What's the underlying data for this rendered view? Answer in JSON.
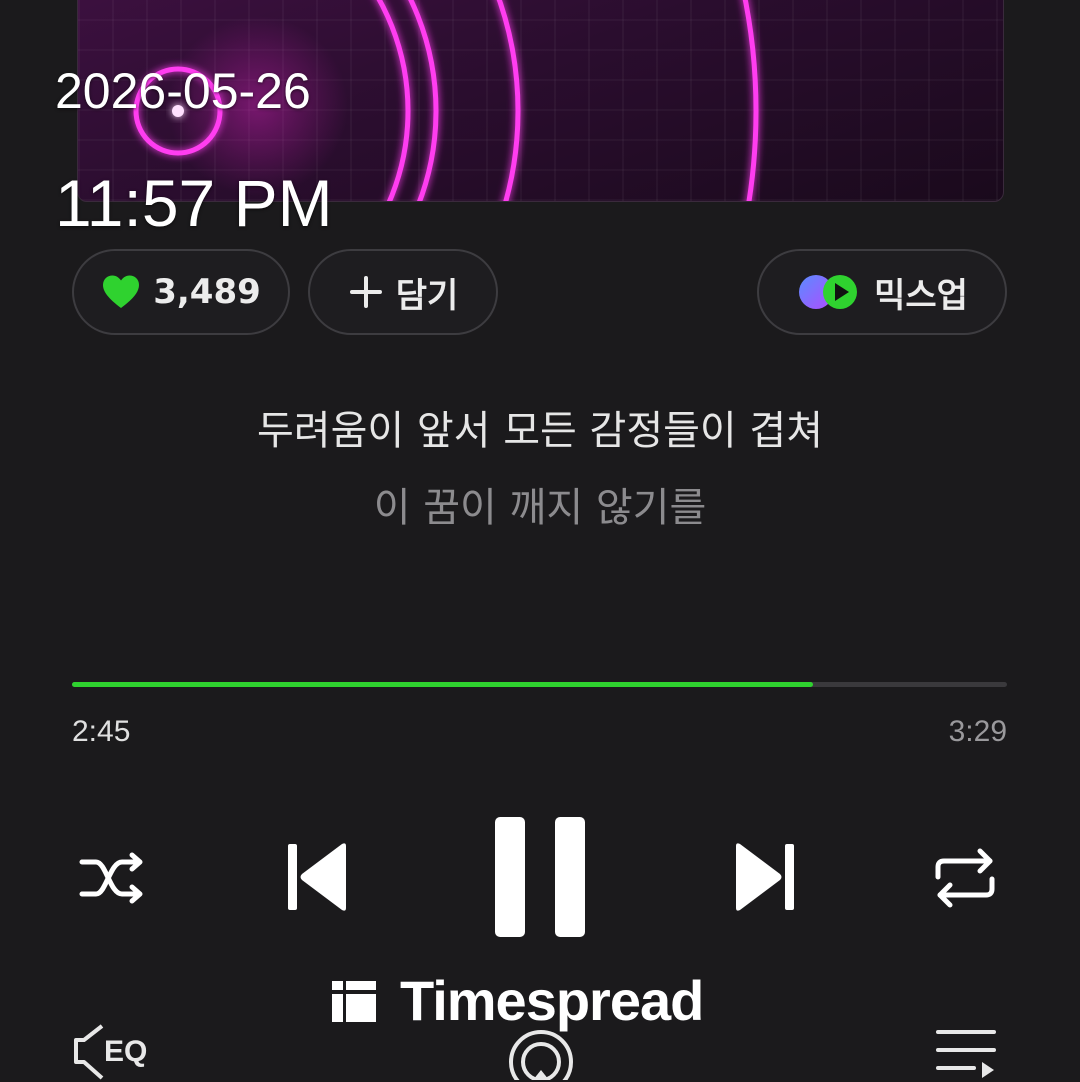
{
  "overlay": {
    "date": "2026-05-26",
    "time": "11:57 PM"
  },
  "actions": {
    "like_count": "3,489",
    "add_label": "담기",
    "mixup_label": "믹스업"
  },
  "lyrics": {
    "current": "두려움이 앞서 모든 감정들이 겹쳐",
    "next": "이 꿈이 깨지 않기를"
  },
  "progress": {
    "elapsed": "2:45",
    "total": "3:29",
    "fraction": 0.793
  },
  "controls": {
    "shuffle": "shuffle-icon",
    "previous": "previous-icon",
    "play_state": "pause-icon",
    "next": "next-icon",
    "repeat": "repeat-icon"
  },
  "bottom_bar": {
    "eq_label": "EQ"
  },
  "watermark": {
    "text": "Timespread"
  },
  "colors": {
    "accent": "#2fd22f",
    "like_heart": "#2fd22f",
    "background": "#1b1a1c"
  }
}
